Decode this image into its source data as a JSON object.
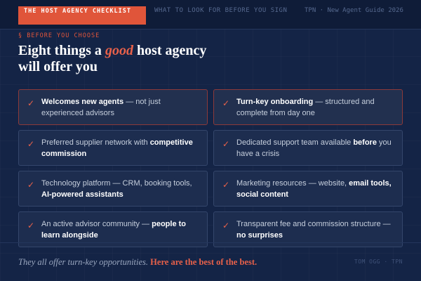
{
  "header": {
    "badge": "THE HOST AGENCY CHECKLIST",
    "subtitle": "WHAT TO LOOK FOR BEFORE YOU SIGN",
    "source": "TPN · New Agent Guide 2026"
  },
  "eyebrow": "§ BEFORE YOU CHOOSE",
  "headline": {
    "before": "Eight things a ",
    "emphasis": "good",
    "after": " host agency will offer you"
  },
  "check_glyph": "✓",
  "cards": [
    {
      "pre": "",
      "bold": "Welcomes new agents",
      "post": " — not just experienced advisors",
      "highlight": true
    },
    {
      "pre": "",
      "bold": "Turn-key onboarding",
      "post": " — structured and complete from day one",
      "highlight": true
    },
    {
      "pre": "Preferred supplier network with ",
      "bold": "competitive commission",
      "post": "",
      "highlight": false
    },
    {
      "pre": "Dedicated support team available ",
      "bold": "before",
      "post": " you have a crisis",
      "highlight": false
    },
    {
      "pre": "Technology platform — CRM, booking tools, ",
      "bold": "AI-powered assistants",
      "post": "",
      "highlight": false
    },
    {
      "pre": "Marketing resources — website, ",
      "bold": "email tools, social content",
      "post": "",
      "highlight": false
    },
    {
      "pre": "An active advisor community — ",
      "bold": "people to learn alongside",
      "post": "",
      "highlight": false
    },
    {
      "pre": "Transparent fee and commission structure — ",
      "bold": "no surprises",
      "post": "",
      "highlight": false
    }
  ],
  "footer": {
    "italic": "They all offer turn-key opportunities.",
    "strong": "Here are the best of the best.",
    "credit": "TOM OGG · TPN"
  }
}
